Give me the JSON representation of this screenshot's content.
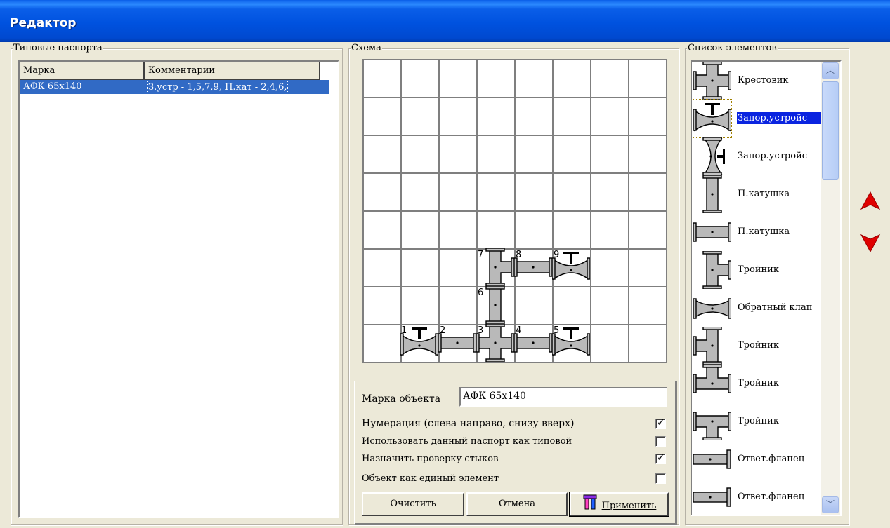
{
  "window": {
    "title": "Редактор"
  },
  "left_panel": {
    "legend": "Типовые паспорта",
    "columns": [
      "Марка",
      "Комментарии"
    ],
    "rows": [
      {
        "mark": "АФК 65х140",
        "comment": "З.устр - 1,5,7,9, П.кат - 2,4,6,"
      }
    ]
  },
  "scheme": {
    "legend": "Схема",
    "grid": {
      "cols": 8,
      "rows": 8
    },
    "element_numbers": [
      "1",
      "2",
      "3",
      "4",
      "5",
      "6",
      "7",
      "8",
      "9"
    ]
  },
  "object_form": {
    "mark_label": "Марка объекта",
    "mark_value": "АФК 65х140",
    "options": [
      {
        "label": "Нумерация (слева направо, снизу вверх)",
        "checked": true
      },
      {
        "label": "Использовать данный паспорт как типовой",
        "checked": false
      },
      {
        "label": "Назначить проверку стыков",
        "checked": true
      },
      {
        "label": "Объект как единый элемент",
        "checked": false
      }
    ],
    "buttons": {
      "clear": "Очистить",
      "cancel": "Отмена",
      "apply": "Применить"
    }
  },
  "elements_list": {
    "legend": "Список элементов",
    "items": [
      {
        "label": "Крестовик",
        "icon": "cross-fitting-icon",
        "selected": false
      },
      {
        "label": "Запор.устройс",
        "icon": "shutoff-valve-icon",
        "selected": true
      },
      {
        "label": "Запор.устройс",
        "icon": "shutoff-valve-vertical-icon",
        "selected": false
      },
      {
        "label": "П.катушка",
        "icon": "pipe-spool-vertical-icon",
        "selected": false
      },
      {
        "label": "П.катушка",
        "icon": "pipe-spool-horizontal-icon",
        "selected": false
      },
      {
        "label": "Тройник",
        "icon": "tee-fitting-icon",
        "selected": false
      },
      {
        "label": "Обратный клап",
        "icon": "check-valve-icon",
        "selected": false
      },
      {
        "label": "Тройник",
        "icon": "tee-fitting-icon",
        "selected": false
      },
      {
        "label": "Тройник",
        "icon": "tee-fitting-icon",
        "selected": false
      },
      {
        "label": "Тройник",
        "icon": "tee-fitting-icon",
        "selected": false
      },
      {
        "label": "Ответ.фланец",
        "icon": "counter-flange-icon",
        "selected": false
      },
      {
        "label": "Ответ.фланец",
        "icon": "counter-flange-icon",
        "selected": false
      }
    ]
  },
  "move_buttons": {
    "up_icon": "move-up-arrow-icon",
    "down_icon": "move-down-arrow-icon"
  },
  "colors": {
    "titlebar": "#0054e3",
    "selection": "#316ac5",
    "list_selection": "#0a24e0",
    "arrows": "#e00000"
  }
}
